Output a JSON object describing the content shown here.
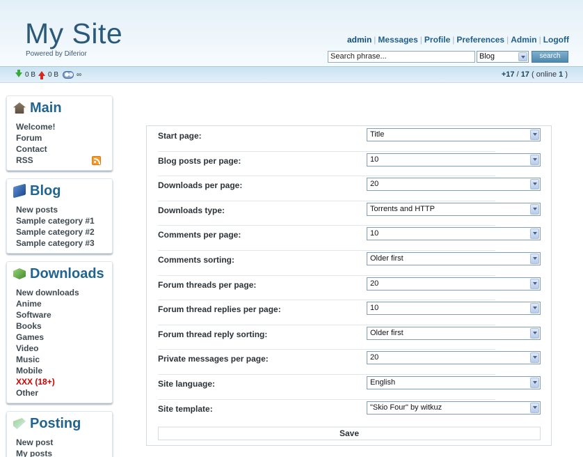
{
  "header": {
    "site_title": "My Site",
    "powered_by": "Powered by Diferior",
    "nav": {
      "user": "admin",
      "messages": "Messages",
      "profile": "Profile",
      "preferences": "Preferences",
      "admin": "Admin",
      "logoff": "Logoff"
    },
    "search": {
      "placeholder": "Search phrase...",
      "scope_selected": "Blog",
      "button": "search"
    }
  },
  "statusbar": {
    "download_amount": "0 B",
    "upload_amount": "0 B",
    "ratio": "∞",
    "users_prefix": "+17",
    "users_sep": " / ",
    "users_total": "17",
    "online_open": " ( online ",
    "online_count": "1",
    "online_close": " )"
  },
  "sidebar": {
    "main": {
      "title": "Main",
      "items": [
        "Welcome!",
        "Forum",
        "Contact",
        "RSS"
      ]
    },
    "blog": {
      "title": "Blog",
      "items": [
        "New posts",
        "Sample category #1",
        "Sample category #2",
        "Sample category #3"
      ]
    },
    "downloads": {
      "title": "Downloads",
      "items": [
        "New downloads",
        "Anime",
        "Software",
        "Books",
        "Games",
        "Video",
        "Music",
        "Mobile",
        "XXX (18+)",
        "Other"
      ]
    },
    "posting": {
      "title": "Posting",
      "items": [
        "New post",
        "My posts"
      ]
    }
  },
  "settings": {
    "rows": [
      {
        "label": "Start page:",
        "value": "Title"
      },
      {
        "label": "Blog posts per page:",
        "value": "10"
      },
      {
        "label": "Downloads per page:",
        "value": "20"
      },
      {
        "label": "Downloads type:",
        "value": "Torrents and HTTP"
      },
      {
        "label": "Comments per page:",
        "value": "10"
      },
      {
        "label": "Comments sorting:",
        "value": "Older first"
      },
      {
        "label": "Forum threads per page:",
        "value": "20"
      },
      {
        "label": "Forum thread replies per page:",
        "value": "10"
      },
      {
        "label": "Forum thread reply sorting:",
        "value": "Older first"
      },
      {
        "label": "Private messages per page:",
        "value": "20"
      },
      {
        "label": "Site language:",
        "value": "English"
      },
      {
        "label": "Site template:",
        "value": "\"Skio Four\" by witkuz"
      }
    ],
    "save_label": "Save"
  },
  "colors": {
    "title": "#2b5a78",
    "link": "#1d5e8b",
    "box_title": "#21648f",
    "adult_item": "#d00000"
  }
}
